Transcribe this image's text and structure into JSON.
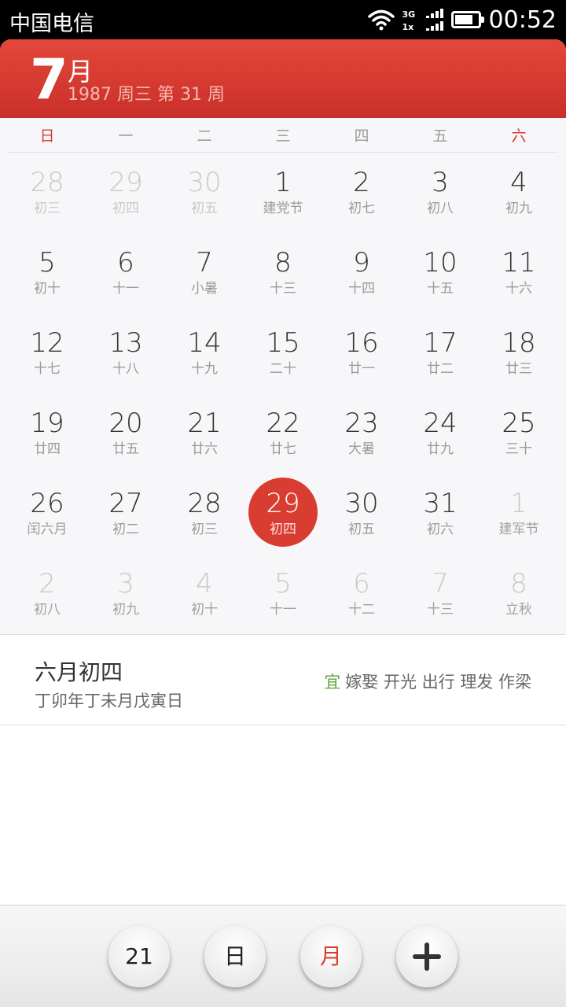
{
  "statusbar": {
    "carrier": "中国电信",
    "network_top": "3G",
    "network_bottom": "1x",
    "time": "00:52"
  },
  "header": {
    "month": "7",
    "month_unit": "月",
    "subtitle": "1987  周三  第 31 周"
  },
  "weekdays": [
    "日",
    "一",
    "二",
    "三",
    "四",
    "五",
    "六"
  ],
  "calendar": {
    "weeks": [
      [
        {
          "d": "28",
          "l": "初三",
          "other": true
        },
        {
          "d": "29",
          "l": "初四",
          "other": true
        },
        {
          "d": "30",
          "l": "初五",
          "other": true
        },
        {
          "d": "1",
          "l": "建党节"
        },
        {
          "d": "2",
          "l": "初七"
        },
        {
          "d": "3",
          "l": "初八"
        },
        {
          "d": "4",
          "l": "初九"
        }
      ],
      [
        {
          "d": "5",
          "l": "初十"
        },
        {
          "d": "6",
          "l": "十一"
        },
        {
          "d": "7",
          "l": "小暑"
        },
        {
          "d": "8",
          "l": "十三"
        },
        {
          "d": "9",
          "l": "十四"
        },
        {
          "d": "10",
          "l": "十五"
        },
        {
          "d": "11",
          "l": "十六"
        }
      ],
      [
        {
          "d": "12",
          "l": "十七"
        },
        {
          "d": "13",
          "l": "十八"
        },
        {
          "d": "14",
          "l": "十九"
        },
        {
          "d": "15",
          "l": "二十"
        },
        {
          "d": "16",
          "l": "廿一"
        },
        {
          "d": "17",
          "l": "廿二"
        },
        {
          "d": "18",
          "l": "廿三"
        }
      ],
      [
        {
          "d": "19",
          "l": "廿四"
        },
        {
          "d": "20",
          "l": "廿五"
        },
        {
          "d": "21",
          "l": "廿六"
        },
        {
          "d": "22",
          "l": "廿七"
        },
        {
          "d": "23",
          "l": "大暑"
        },
        {
          "d": "24",
          "l": "廿九"
        },
        {
          "d": "25",
          "l": "三十"
        }
      ],
      [
        {
          "d": "26",
          "l": "闰六月"
        },
        {
          "d": "27",
          "l": "初二"
        },
        {
          "d": "28",
          "l": "初三"
        },
        {
          "d": "29",
          "l": "初四",
          "selected": true
        },
        {
          "d": "30",
          "l": "初五"
        },
        {
          "d": "31",
          "l": "初六"
        },
        {
          "d": "1",
          "l": "建军节",
          "other": true
        }
      ],
      [
        {
          "d": "2",
          "l": "初八",
          "other": true
        },
        {
          "d": "3",
          "l": "初九",
          "other": true
        },
        {
          "d": "4",
          "l": "初十",
          "other": true
        },
        {
          "d": "5",
          "l": "十一",
          "other": true
        },
        {
          "d": "6",
          "l": "十二",
          "other": true
        },
        {
          "d": "7",
          "l": "十三",
          "other": true
        },
        {
          "d": "8",
          "l": "立秋",
          "other": true
        }
      ]
    ]
  },
  "info": {
    "lunar_date": "六月初四",
    "ganzhi": "丁卯年丁未月戊寅日",
    "yi_label": "宜",
    "yi_items": "嫁娶 开光 出行 理发 作梁"
  },
  "bottom": {
    "today_label": "21",
    "day_label": "日",
    "month_label": "月"
  },
  "colors": {
    "accent": "#d93d31",
    "yi": "#5fa640"
  }
}
